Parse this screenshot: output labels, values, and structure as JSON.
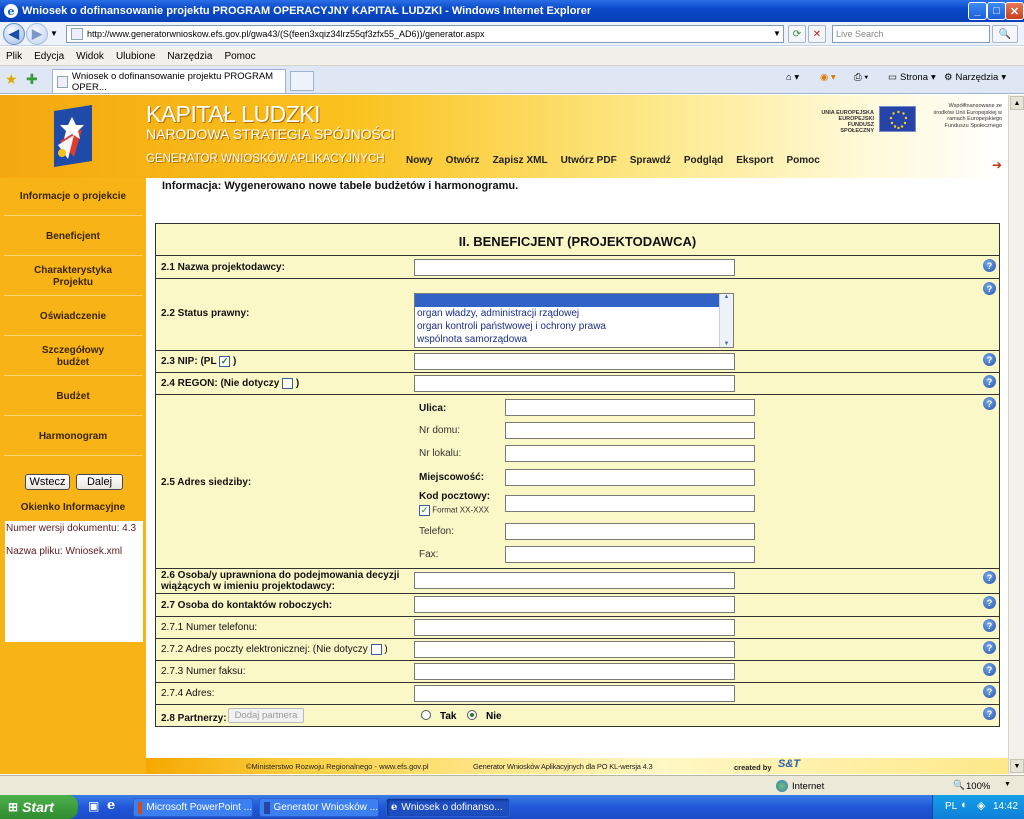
{
  "window": {
    "title": "Wniosek o dofinansowanie projektu PROGRAM OPERACYJNY KAPITAŁ LUDZKI - Windows Internet Explorer",
    "minimize": "_",
    "maximize": "□",
    "close": "✕"
  },
  "browser": {
    "address": "http://www.generatorwnioskow.efs.gov.pl/gwa43/(S(feen3xqiz34lrz55qf3zfx55_AD6))/generator.aspx",
    "search_placeholder": "Live Search",
    "menu": [
      "Plik",
      "Edycja",
      "Widok",
      "Ulubione",
      "Narzędzia",
      "Pomoc"
    ],
    "tab_title": "Wniosek o dofinansowanie projektu PROGRAM OPER...",
    "toolbar_strona": "Strona",
    "toolbar_narzedzia": "Narzędzia"
  },
  "header": {
    "brand_line1": "KAPITAŁ LUDZKI",
    "brand_line2": "NARODOWA STRATEGIA SPÓJNOŚCI",
    "brand_line3": "GENERATOR WNIOSKÓW APLIKACYJNYCH",
    "nav": [
      "Nowy",
      "Otwórz",
      "Zapisz XML",
      "Utwórz PDF",
      "Sprawdź",
      "Podgląd",
      "Eksport",
      "Pomoc"
    ],
    "eu_text": "UNIA EUROPEJSKA EUROPEJSKI FUNDUSZ SPOŁECZNY",
    "cofinanced_text": "Współfinansowane ze środków Unii Europejskiej w ramach Europejskiego Funduszu Społecznego"
  },
  "sidebar": {
    "items": [
      "Informacje o projekcie",
      "Beneficjent",
      "Charakterystyka Projektu",
      "Oświadczenie",
      "Szczegółowy budżet",
      "Budżet",
      "Harmonogram"
    ],
    "back_button": "Wstecz",
    "next_button": "Dalej",
    "info_title": "Okienko Informacyjne",
    "doc_version": "Numer wersji dokumentu: 4.3",
    "file_name": "Nazwa pliku: Wniosek.xml"
  },
  "main": {
    "info_message": "Informacja: Wygenerowano nowe tabele budżetów i harmonogramu.",
    "section_title": "II. BENEFICJENT (PROJEKTODAWCA)",
    "labels": {
      "name": "2.1 Nazwa projektodawcy:",
      "status": "2.2 Status prawny:",
      "nip": "2.3 NIP: (PL",
      "nip_close": ")",
      "regon": "2.4 REGON: (Nie dotyczy",
      "regon_close": ")",
      "address": "2.5 Adres siedziby:",
      "authorized_1": "2.6 Osoba/y uprawniona do podejmowania decyzji",
      "authorized_2": "wiążących w imieniu projektodawcy:",
      "contact": "2.7 Osoba do kontaktów roboczych:",
      "phone": "2.7.1 Numer telefonu:",
      "email": "2.7.2 Adres poczty elektronicznej: (Nie dotyczy",
      "email_close": ")",
      "fax": "2.7.3 Numer faksu:",
      "contact_address": "2.7.4 Adres:",
      "partners": "2.8 Partnerzy:"
    },
    "address_fields": {
      "street": "Ulica:",
      "house": "Nr domu:",
      "flat": "Nr lokalu:",
      "city": "Miejscowość:",
      "postcode": "Kod pocztowy:",
      "postcode_format": "Format XX-XXX",
      "phone": "Telefon:",
      "fax": "Fax:"
    },
    "status_options": [
      "",
      "organ władzy, administracji rządowej",
      "organ kontroli państwowej i ochrony prawa",
      "wspólnota samorządowa"
    ],
    "add_partner_button": "Dodaj partnera",
    "radio_yes": "Tak",
    "radio_no": "Nie",
    "nip_checked": true,
    "postcode_format_checked": true,
    "partners_selected": "Nie",
    "help_glyph": "?"
  },
  "footer": {
    "ministry": "©Ministerstwo Rozwoju Regionalnego - www.efs.gov.pl",
    "generator": "Generator Wniosków Aplikacyjnych dla PO KL-wersja 4.3",
    "created_by": "created by",
    "logo": "S&T"
  },
  "statusbar": {
    "zone": "Internet",
    "zoom": "100%"
  },
  "taskbar": {
    "start": "Start",
    "tasks": [
      "Microsoft PowerPoint ...",
      "Generator Wniosków ...",
      "Wniosek o dofinanso..."
    ],
    "lang": "PL",
    "clock": "14:42"
  }
}
